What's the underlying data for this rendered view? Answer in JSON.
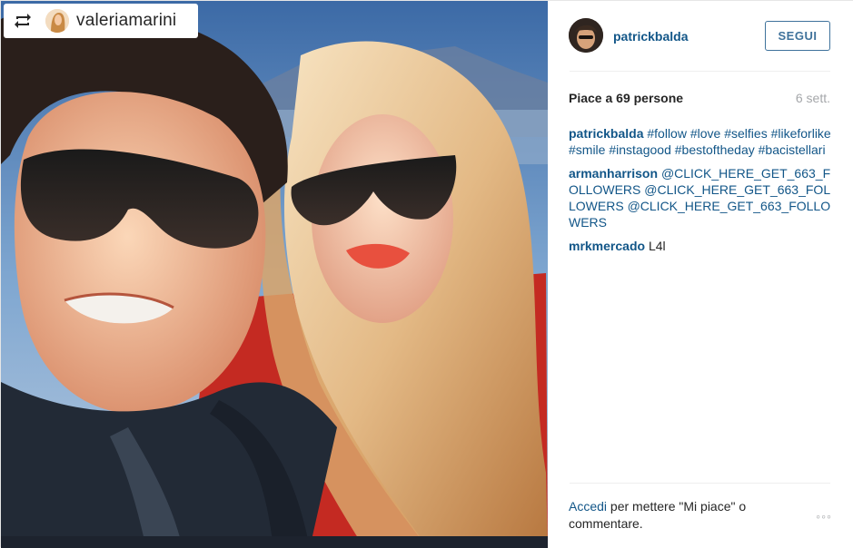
{
  "photo": {
    "badge_username": "valeriamarini",
    "repost_icon": "repost-icon"
  },
  "header": {
    "username": "patrickbalda",
    "follow_label": "SEGUI"
  },
  "stats": {
    "likes": "Piace a 69 persone",
    "age": "6 sett."
  },
  "comments": [
    {
      "user": "patrickbalda",
      "tokens": [
        {
          "text": "#follow",
          "tag": true
        },
        {
          "text": " ",
          "tag": false
        },
        {
          "text": "#love",
          "tag": true
        },
        {
          "text": " ",
          "tag": false
        },
        {
          "text": "#selfies",
          "tag": true
        },
        {
          "text": " ",
          "tag": false
        },
        {
          "text": "#likeforlike",
          "tag": true
        },
        {
          "text": " ",
          "tag": false
        },
        {
          "text": "#smile",
          "tag": true
        },
        {
          "text": " ",
          "tag": false
        },
        {
          "text": "#instagood",
          "tag": true
        },
        {
          "text": " ",
          "tag": false
        },
        {
          "text": "#bestoftheday",
          "tag": true
        },
        {
          "text": " ",
          "tag": false
        },
        {
          "text": "#bacistellari",
          "tag": true
        }
      ]
    },
    {
      "user": "armanharrison",
      "tokens": [
        {
          "text": "@CLICK_HERE_GET_663_FOLLOWERS",
          "tag": true
        },
        {
          "text": " ",
          "tag": false
        },
        {
          "text": "@CLICK_HERE_GET_663_FOLLOWERS",
          "tag": true
        },
        {
          "text": " ",
          "tag": false
        },
        {
          "text": "@CLICK_HERE_GET_663_FOLLOWERS",
          "tag": true
        }
      ]
    },
    {
      "user": "mrkmercado",
      "tokens": [
        {
          "text": "L4l",
          "tag": false
        }
      ]
    }
  ],
  "footer": {
    "login_link": "Accedi",
    "login_text": " per mettere \"Mi piace\" o commentare.",
    "more_label": "◦◦◦",
    "more_icon": "more-options-icon"
  },
  "colors": {
    "link": "#125688",
    "button_border": "#3f729b",
    "muted": "#a5a7aa",
    "text": "#262626"
  }
}
